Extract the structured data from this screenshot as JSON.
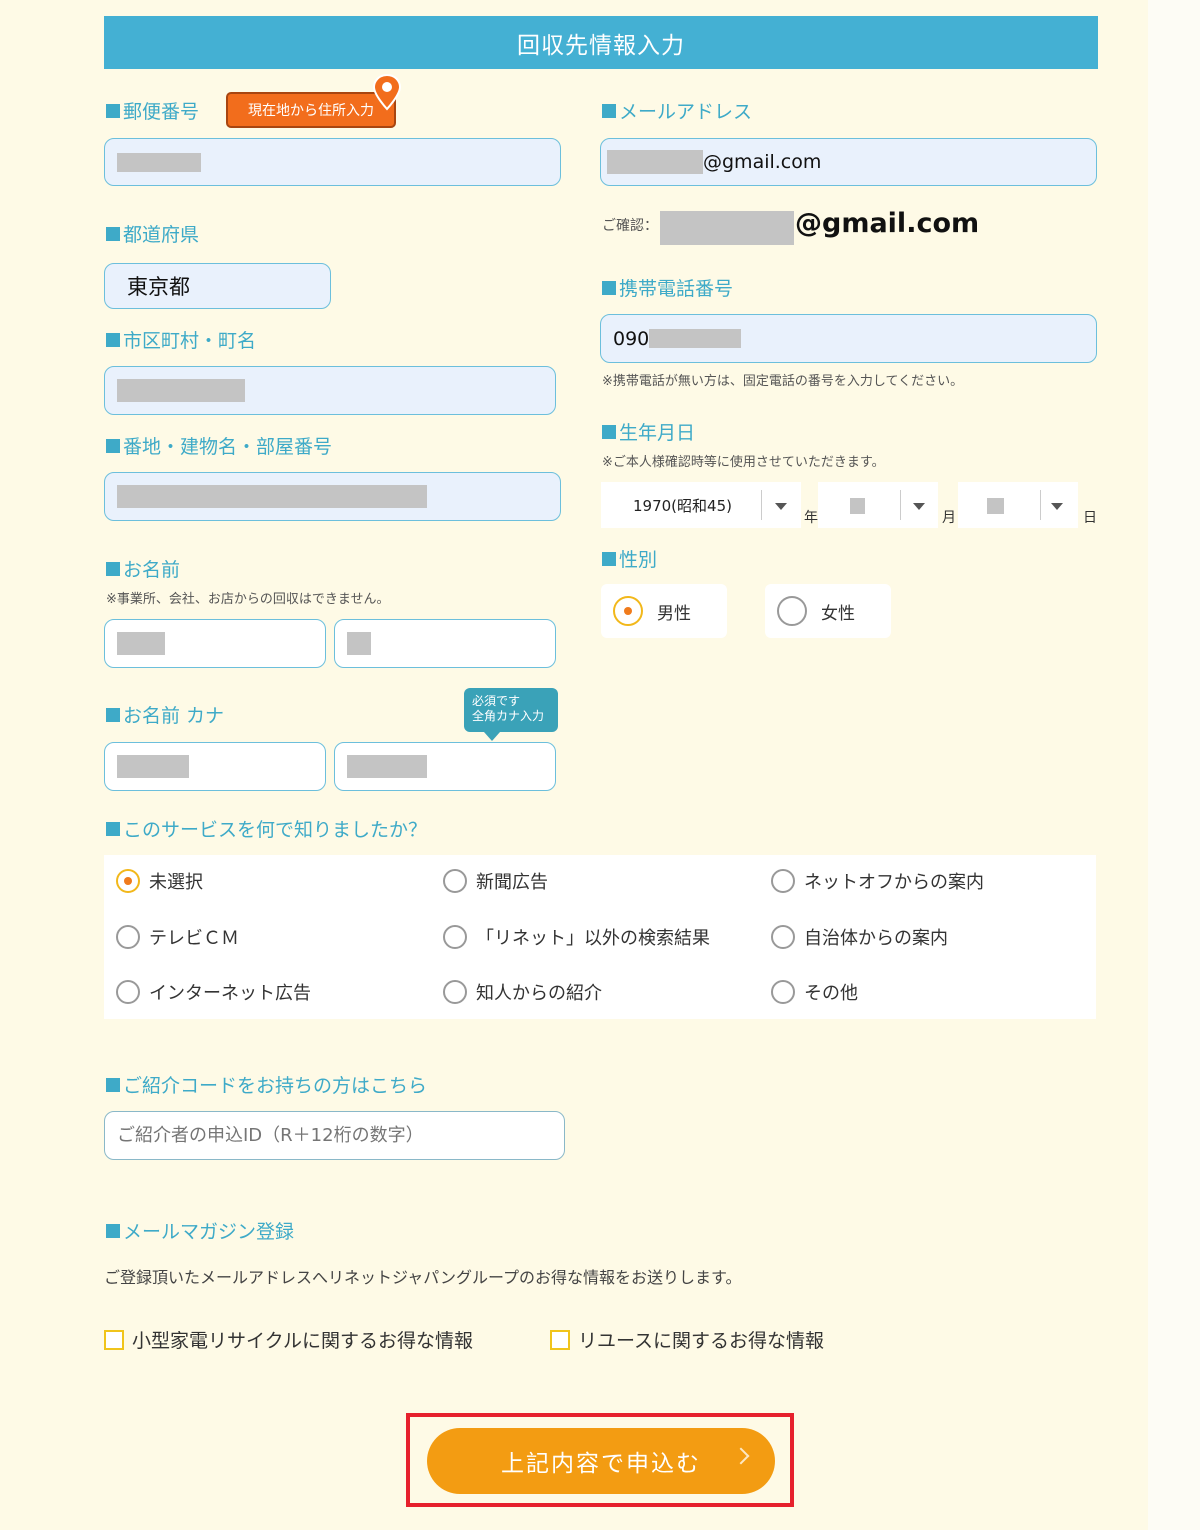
{
  "header": {
    "title": "回収先情報入力"
  },
  "postal": {
    "label": "郵便番号",
    "geo_button": "現在地から住所入力"
  },
  "prefecture": {
    "label": "都道府県",
    "value": "東京都"
  },
  "city": {
    "label": "市区町村・町名"
  },
  "street": {
    "label": "番地・建物名・部屋番号"
  },
  "name": {
    "label": "お名前",
    "note": "※事業所、会社、お店からの回収はできません。"
  },
  "kana": {
    "label": "お名前 カナ",
    "tooltip_line1": "必須です",
    "tooltip_line2": "全角カナ入力"
  },
  "email": {
    "label": "メールアドレス",
    "domain": "@gmail.com",
    "confirm_label": "ご確認：",
    "confirm_domain": "@gmail.com"
  },
  "mobile": {
    "label": "携帯電話番号",
    "value_prefix": "090",
    "note": "※携帯電話が無い方は、固定電話の番号を入力してください。"
  },
  "birth": {
    "label": "生年月日",
    "note": "※ご本人様確認時等に使用させていただきます。",
    "year_value": "1970(昭和45)",
    "year_unit": "年",
    "month_unit": "月",
    "day_unit": "日"
  },
  "gender": {
    "label": "性別",
    "options": [
      "男性",
      "女性"
    ],
    "selected": "男性"
  },
  "survey": {
    "label": "このサービスを何で知りましたか？",
    "options": [
      "未選択",
      "新聞広告",
      "ネットオフからの案内",
      "テレビＣＭ",
      "「リネット」以外の検索結果",
      "自治体からの案内",
      "インターネット広告",
      "知人からの紹介",
      "その他"
    ],
    "selected": "未選択"
  },
  "referral": {
    "label": "ご紹介コードをお持ちの方はこちら",
    "placeholder": "ご紹介者の申込ID（R＋12桁の数字）"
  },
  "newsletter": {
    "label": "メールマガジン登録",
    "description": "ご登録頂いたメールアドレスへリネットジャパングループのお得な情報をお送りします。",
    "options": [
      "小型家電リサイクルに関するお得な情報",
      "リユースに関するお得な情報"
    ]
  },
  "submit": {
    "label": "上記内容で申込む"
  },
  "colors": {
    "accent": "#44b0d3",
    "label": "#3eaac8",
    "orange": "#f39c12",
    "highlight_frame": "#e6202c"
  }
}
